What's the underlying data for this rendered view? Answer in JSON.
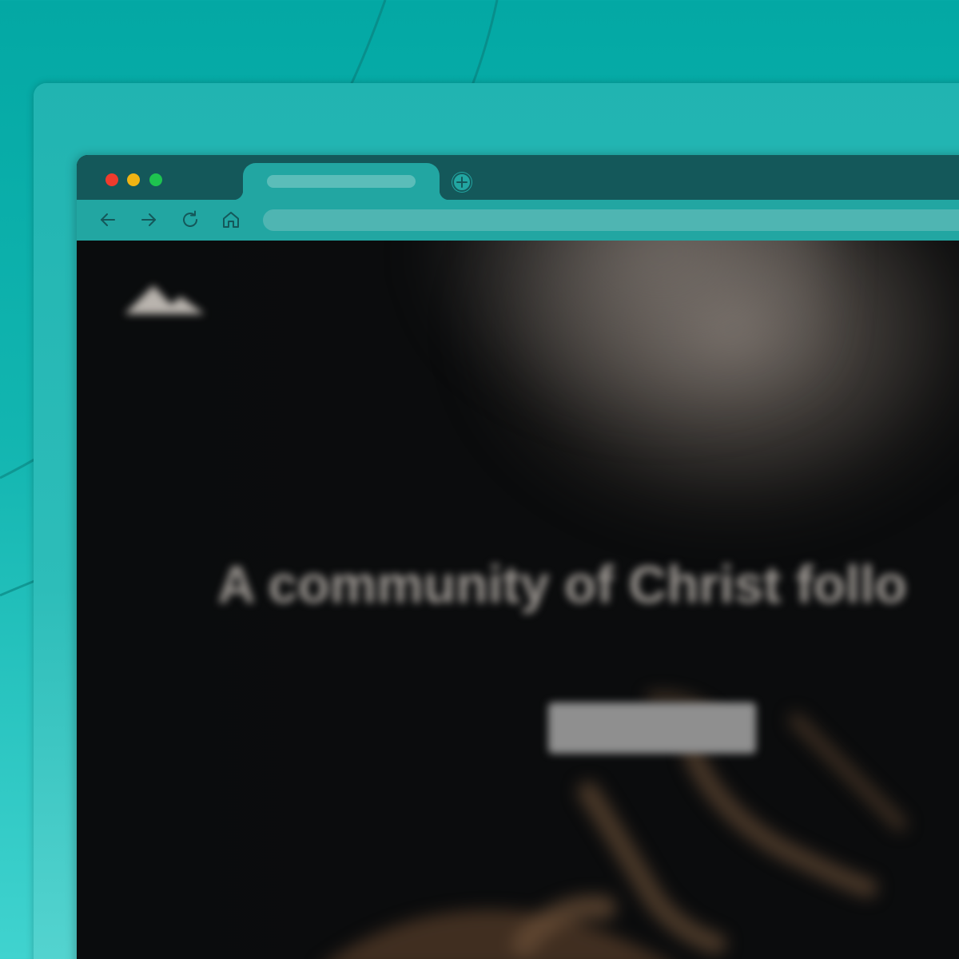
{
  "colors": {
    "background_top": "#03a8a4",
    "background_bottom": "#40d3cf",
    "tab_strip": "#14585a",
    "toolbar": "#22a6a2",
    "address_bar": "#4fb5b2",
    "traffic_red": "#ef3b2d",
    "traffic_yellow": "#f0b414",
    "traffic_green": "#1ec34f"
  },
  "browser": {
    "icons": {
      "new_tab": "plus-icon",
      "back": "arrow-left-icon",
      "forward": "arrow-right-icon",
      "reload": "reload-icon",
      "home": "home-icon"
    }
  },
  "website": {
    "hero": {
      "title": "A community of Christ follo"
    }
  }
}
